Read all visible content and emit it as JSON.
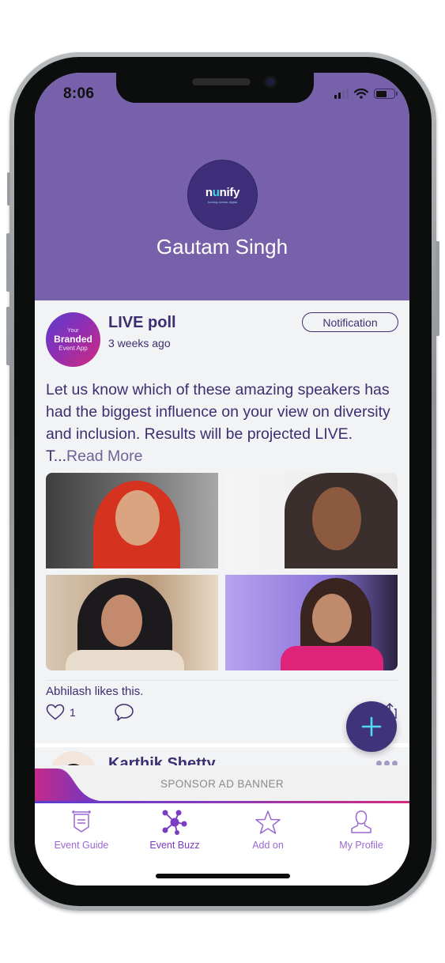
{
  "status_bar": {
    "time": "8:06",
    "icons": [
      "cellular-signal-icon",
      "wifi-icon",
      "battery-icon"
    ]
  },
  "header": {
    "logo_text_prefix": "n",
    "logo_text_accent": "u",
    "logo_text_suffix": "nify",
    "logo_tagline": "turning events digital",
    "user_name": "Gautam Singh",
    "background_color": "#7761aa"
  },
  "post": {
    "avatar_line1": "Your",
    "avatar_line2": "Branded",
    "avatar_line3": "Event App",
    "title": "LIVE poll",
    "time_ago": "3 weeks ago",
    "tag_button": "Notification",
    "body": "Let us know which of these amazing speakers has had the biggest influence on your view on diversity and inclusion. Results will be projected LIVE. T...",
    "read_more": "Read More",
    "images": [
      {
        "description": "speaker-photo-1"
      },
      {
        "description": "speaker-photo-2"
      },
      {
        "description": "speaker-photo-3"
      },
      {
        "description": "speaker-photo-4"
      }
    ],
    "likes_text": "Abhilash likes this.",
    "like_count": "1"
  },
  "next_post": {
    "author": "Karthik Shetty"
  },
  "fab": {
    "icon": "plus-icon"
  },
  "ad_banner": {
    "text": "SPONSOR AD BANNER"
  },
  "tabbar": {
    "active_tab": "Event Buzz",
    "tabs": [
      {
        "label": "Event Guide",
        "icon": "signboard-icon"
      },
      {
        "label": "Event Buzz",
        "icon": "network-icon"
      },
      {
        "label": "Add on",
        "icon": "star-icon"
      },
      {
        "label": "My Profile",
        "icon": "user-icon"
      }
    ]
  },
  "colors": {
    "primary_text": "#3b2f72",
    "tab_color": "#9b68d0",
    "tab_active": "#7b3bc2",
    "fab": "#3f347a",
    "fab_plus": "#4fdcef"
  }
}
